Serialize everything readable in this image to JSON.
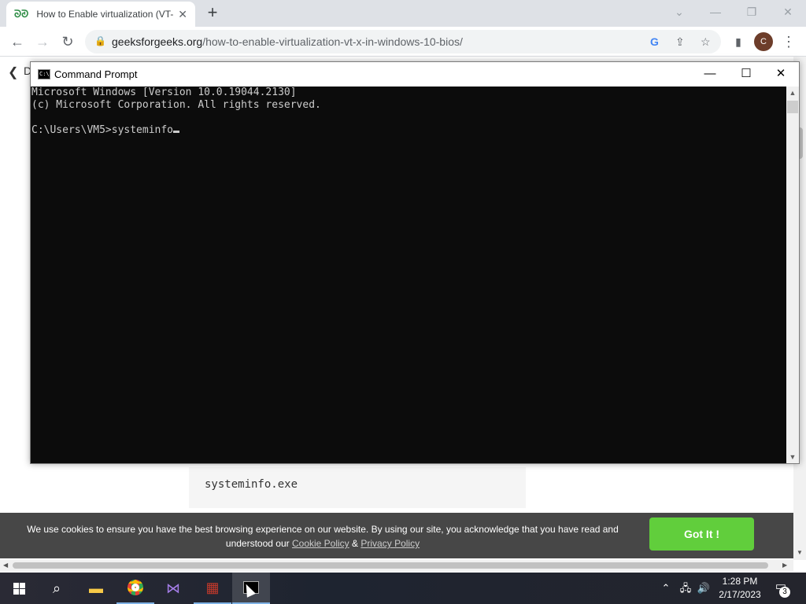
{
  "browser": {
    "tab_title": "How to Enable virtualization (VT-",
    "tab_favicon": "geeksforgeeks-logo-icon",
    "url_domain": "geeksforgeeks.org",
    "url_path": "/how-to-enable-virtualization-vt-x-in-windows-10-bios/",
    "profile_initial": "C"
  },
  "page": {
    "partial_heading_letter": "D",
    "code_block": "systeminfo.exe",
    "cookie": {
      "message": "We use cookies to ensure you have the best browsing experience on our website. By using our site, you acknowledge that you have read and understood our",
      "cookie_policy": "Cookie Policy",
      "amp": "&",
      "privacy_policy": "Privacy Policy",
      "button": "Got It !"
    }
  },
  "cmd": {
    "title": "Command Prompt",
    "lines": [
      "Microsoft Windows [Version 10.0.19044.2130]",
      "(c) Microsoft Corporation. All rights reserved.",
      "",
      "C:\\Users\\VM5>systeminfo"
    ]
  },
  "taskbar": {
    "time": "1:28 PM",
    "date": "2/17/2023",
    "notification_count": "3"
  },
  "colors": {
    "cookie_button": "#61ce3c",
    "console_bg": "#0c0c0c",
    "console_text": "#cccccc"
  }
}
